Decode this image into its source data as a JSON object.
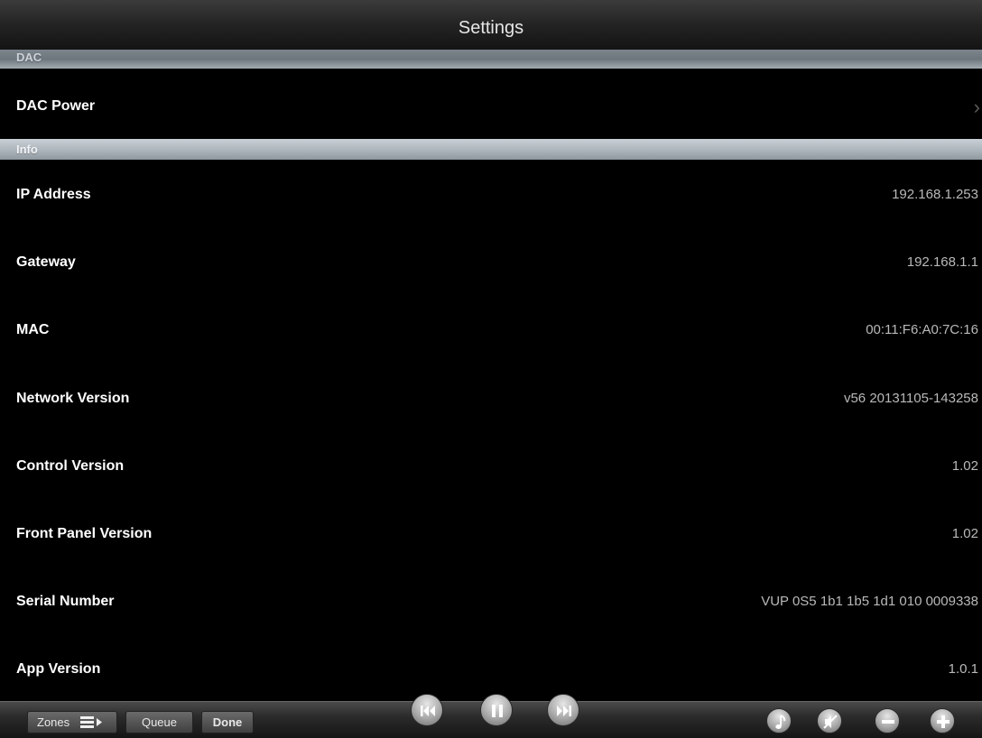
{
  "header": {
    "title": "Settings"
  },
  "sections": {
    "dac": {
      "title": "DAC",
      "rows": [
        {
          "label": "DAC Power",
          "chevron": "›"
        }
      ]
    },
    "info": {
      "title": "Info",
      "rows": [
        {
          "label": "IP Address",
          "value": "192.168.1.253"
        },
        {
          "label": "Gateway",
          "value": "192.168.1.1"
        },
        {
          "label": "MAC",
          "value": "00:11:F6:A0:7C:16"
        },
        {
          "label": "Network Version",
          "value": "v56 20131105-143258"
        },
        {
          "label": "Control Version",
          "value": "1.02"
        },
        {
          "label": "Front Panel Version",
          "value": "1.02"
        },
        {
          "label": "Serial Number",
          "value": "VUP 0S5 1b1 1b5 1d1 010 0009338"
        },
        {
          "label": "App Version",
          "value": "1.0.1"
        }
      ]
    }
  },
  "toolbar": {
    "zones_label": "Zones",
    "queue_label": "Queue",
    "done_label": "Done",
    "icons": [
      "previous-track-icon",
      "pause-icon",
      "next-track-icon",
      "music-note-icon",
      "mute-icon",
      "volume-down-icon",
      "volume-up-icon"
    ]
  }
}
